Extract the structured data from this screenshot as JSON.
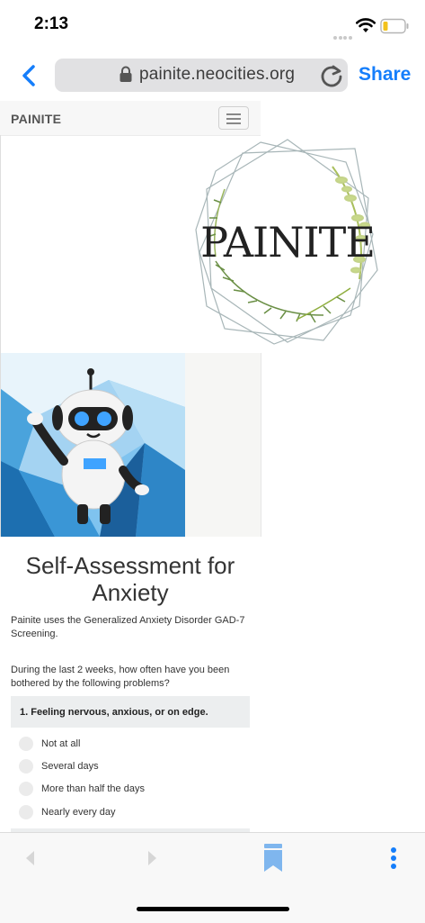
{
  "status": {
    "time": "2:13"
  },
  "browser": {
    "url": "painite.neocities.org",
    "share_label": "Share"
  },
  "site": {
    "brand": "PAINITE",
    "logo_text": "PAINITE"
  },
  "assessment": {
    "title": "Self-Assessment for Anxiety",
    "intro": "Painite uses the Generalized Anxiety Disorder GAD-7 Screening.",
    "question_intro": "During the last 2 weeks, how often have you been bothered by the following problems?",
    "question_1": "1. Feeling nervous, anxious, or on edge.",
    "options": [
      "Not at all",
      "Several days",
      "More than half the days",
      "Nearly every day"
    ]
  },
  "colors": {
    "accent": "#157efb",
    "question_bg": "#eceeef"
  }
}
